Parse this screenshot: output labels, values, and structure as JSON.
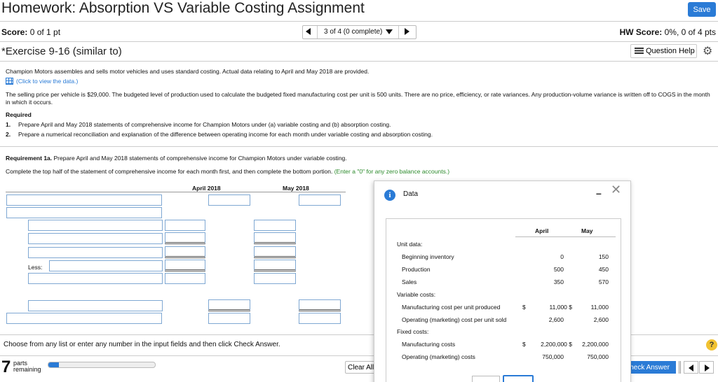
{
  "header": {
    "title": "Homework: Absorption VS Variable Costing Assignment",
    "save_label": "Save",
    "score_label": "Score:",
    "score_value": "0 of 1 pt",
    "nav_text": "3 of 4 (0 complete)",
    "hw_score_label": "HW Score:",
    "hw_score_value": "0%, 0 of 4 pts"
  },
  "exercise": {
    "title": "*Exercise 9-16 (similar to)",
    "question_help": "Question Help",
    "intro": "Champion Motors assembles and sells motor vehicles and uses standard costing. Actual data relating to April and May 2018 are provided.",
    "view_data": "(Click to view the data.)",
    "selling": "The selling price per vehicle is $29,000. The budgeted level of production used to calculate the budgeted fixed manufacturing cost per unit is 500 units. There are no price, efficiency, or rate variances. Any production-volume variance is written off to COGS in the month in which it occurs.",
    "required_head": "Required",
    "req1_num": "1.",
    "req1": "Prepare April and May 2018 statements of comprehensive income for Champion Motors under (a) variable costing and (b) absorption costing.",
    "req2_num": "2.",
    "req2": "Prepare a numerical reconciliation and explanation of the difference between operating income for each month under variable costing and absorption costing.",
    "req1a_bold": "Requirement 1a.",
    "req1a": " Prepare April and May 2018 statements of comprehensive income for Champion Motors under variable costing.",
    "complete": "Complete the top half of the statement of comprehensive income for each month first, and then complete the bottom portion. ",
    "complete_hint": "(Enter a \"0\" for any zero balance accounts.)"
  },
  "table": {
    "col_april": "April 2018",
    "col_may": "May 2018",
    "less_label": "Less:"
  },
  "footer": {
    "choose": "Choose from any list or enter any number in the input fields and then click Check Answer.",
    "parts_count": "7",
    "parts_label_1": "parts",
    "parts_label_2": "remaining",
    "progress_fraction": 0.1,
    "clear_all": "Clear All",
    "check_answer": "Check Answer",
    "help": "?"
  },
  "dialog": {
    "title": "Data",
    "minimize": "–",
    "close": "✕",
    "col_april": "April",
    "col_may": "May",
    "unit_data": "Unit data:",
    "beg_inv": "Beginning inventory",
    "beg_inv_apr": "0",
    "beg_inv_may": "150",
    "production": "Production",
    "production_apr": "500",
    "production_may": "450",
    "sales": "Sales",
    "sales_apr": "350",
    "sales_may": "570",
    "variable_costs": "Variable costs:",
    "mfg_cost": "Manufacturing cost per unit produced",
    "mfg_cost_dollar": "$",
    "mfg_cost_apr": "11,000 $",
    "mfg_cost_may": "11,000",
    "op_cost": "Operating (marketing) cost per unit sold",
    "op_cost_apr": "2,600",
    "op_cost_may": "2,600",
    "fixed_costs": "Fixed costs:",
    "fixed_mfg": "Manufacturing costs",
    "fixed_mfg_dollar": "$",
    "fixed_mfg_apr": "2,200,000 $",
    "fixed_mfg_may": "2,200,000",
    "fixed_op": "Operating (marketing) costs",
    "fixed_op_apr": "750,000",
    "fixed_op_may": "750,000"
  },
  "colors": {
    "accent": "#2a7bd6",
    "hint_green": "#2b8a2b",
    "help_yellow": "#f1c232"
  }
}
